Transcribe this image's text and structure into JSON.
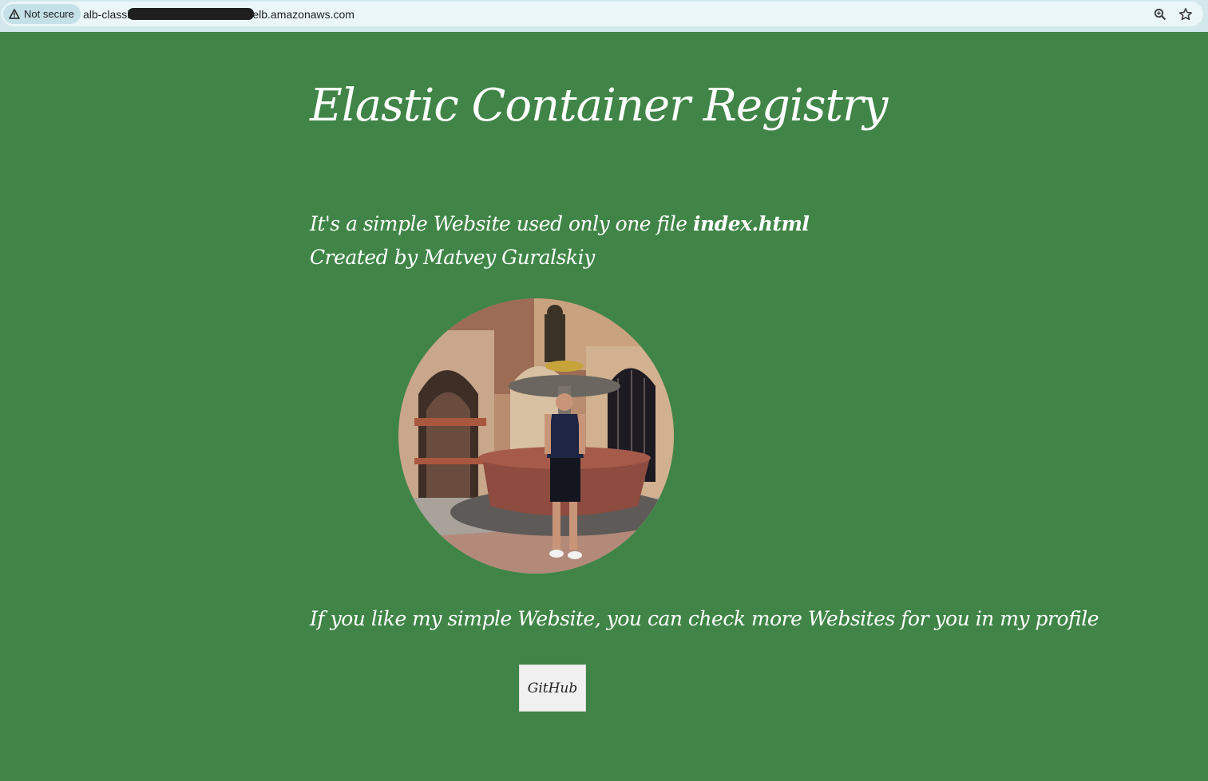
{
  "browser": {
    "security_chip": "Not secure",
    "url_prefix": "alb-classi",
    "url_suffix": "elb.amazonaws.com",
    "icons": [
      "warning-icon",
      "zoom-icon",
      "bookmark-star-icon"
    ]
  },
  "page": {
    "title": "Elastic Container Registry",
    "intro_line1_text": "It's a simple Website used only one file ",
    "intro_line1_bold": "index.html",
    "intro_line2": "Created by Matvey Guralskiy",
    "cta_text": "If you like my simple Website, you can check more Websites for you in my profile",
    "github_button": "GitHub"
  },
  "colors": {
    "background": "#408547",
    "text": "#ffffff",
    "button_bg": "#f0f0f0"
  }
}
